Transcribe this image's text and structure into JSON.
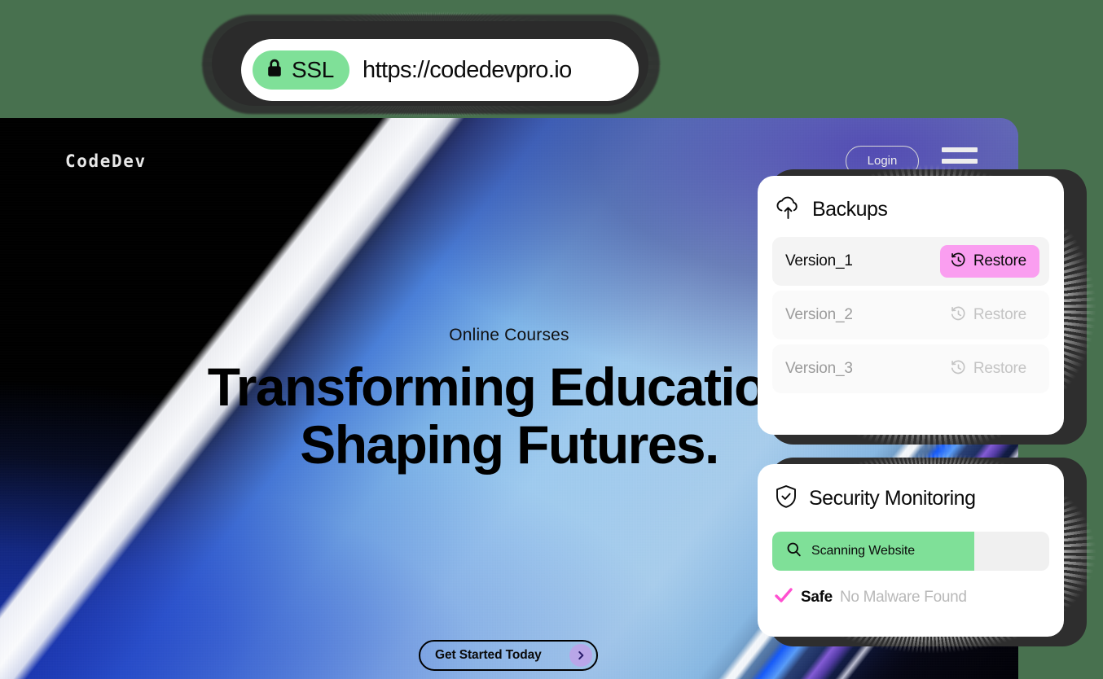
{
  "browser": {
    "ssl_badge_label": "SSL",
    "url": "https://codedevpro.io",
    "lock_icon": "lock-icon"
  },
  "header": {
    "brand": "CodeDev",
    "login_label": "Login",
    "menu_icon": "hamburger-menu-icon"
  },
  "hero": {
    "eyebrow": "Online Courses",
    "title_line_1": "Transforming Education,",
    "title_line_2": "Shaping Futures.",
    "cta_label": "Get Started Today",
    "cta_icon": "chevron-right-icon"
  },
  "backups": {
    "title": "Backups",
    "icon": "cloud-upload-icon",
    "rows": [
      {
        "name": "Version_1",
        "action_label": "Restore",
        "state": "active"
      },
      {
        "name": "Version_2",
        "action_label": "Restore",
        "state": "idle"
      },
      {
        "name": "Version_3",
        "action_label": "Restore",
        "state": "idle"
      }
    ]
  },
  "security": {
    "title": "Security Monitoring",
    "icon": "shield-check-icon",
    "scan_label": "Scanning Website",
    "scan_icon": "search-icon",
    "scan_progress": 73,
    "status_strong": "Safe",
    "status_note": "No Malware Found",
    "status_icon": "check-icon"
  },
  "colors": {
    "page_background": "#48714F",
    "accent_green": "#7FE098",
    "accent_pink": "#FA9EF0",
    "accent_magenta": "#FF4FD0",
    "accent_purple": "#B9A6E8",
    "panel_white": "#FFFFFF",
    "muted_text": "#9C9C9C"
  }
}
